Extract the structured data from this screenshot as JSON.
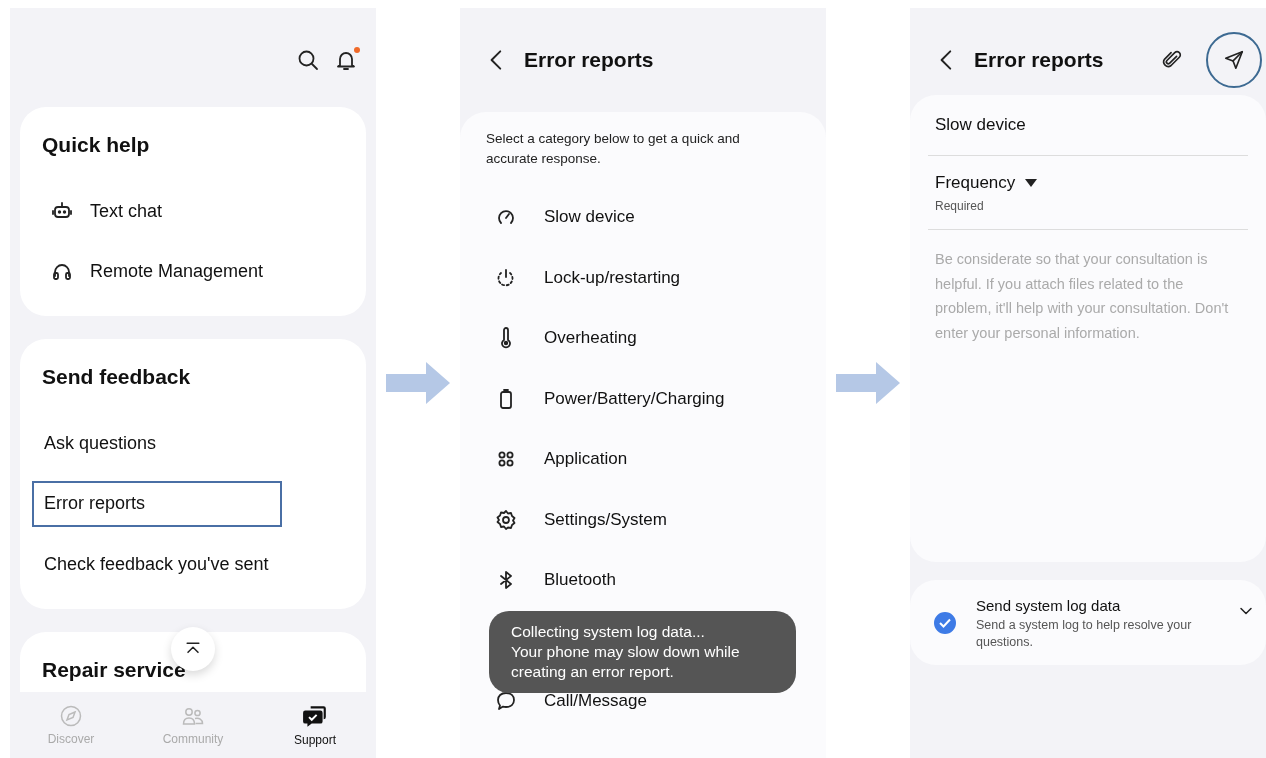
{
  "support_screen": {
    "notification_badge": true,
    "cards": [
      {
        "title": "Quick help",
        "items": [
          {
            "label": "Text chat",
            "highlighted": false
          },
          {
            "label": "Remote Management",
            "highlighted": false
          }
        ]
      },
      {
        "title": "Send feedback",
        "items": [
          {
            "label": "Ask questions",
            "highlighted": false
          },
          {
            "label": "Error reports",
            "highlighted": true
          },
          {
            "label": "Check feedback you've sent",
            "highlighted": false
          }
        ]
      },
      {
        "title": "Repair service"
      }
    ],
    "bottom_nav": [
      {
        "label": "Discover",
        "selected": false
      },
      {
        "label": "Community",
        "selected": false
      },
      {
        "label": "Support",
        "selected": true
      }
    ]
  },
  "categories_screen": {
    "title": "Error reports",
    "intro": "Select a category below to get a quick and accurate response.",
    "categories": [
      {
        "label": "Slow device"
      },
      {
        "label": "Lock-up/restarting"
      },
      {
        "label": "Overheating"
      },
      {
        "label": "Power/Battery/Charging"
      },
      {
        "label": "Application"
      },
      {
        "label": "Settings/System"
      },
      {
        "label": "Bluetooth"
      },
      {
        "label": "Call/Message"
      }
    ],
    "toast": {
      "title": "Collecting system log data...",
      "message": "Your phone may slow down while creating an error report."
    }
  },
  "report_screen": {
    "title": "Error reports",
    "send_highlighted": true,
    "category": "Slow device",
    "frequency": {
      "label": "Frequency",
      "hint": "Required"
    },
    "placeholder": "Be considerate so that your consultation is helpful. If you attach files related to the problem, it'll help with your consultation. Don't enter your personal information.",
    "log_option": {
      "title": "Send system log data",
      "description": "Send a system log to help resolve your questions.",
      "checked": true
    }
  }
}
